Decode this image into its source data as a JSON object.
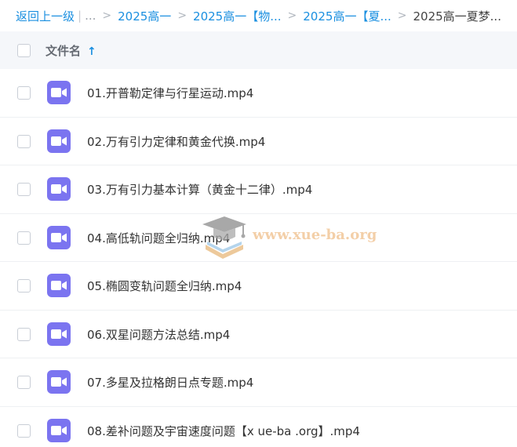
{
  "breadcrumb": {
    "back_label": "返回上一级",
    "ellipsis": "...",
    "items": [
      "2025高一",
      "2025高一【物...",
      "2025高一【夏...",
      "2025高一夏梦..."
    ]
  },
  "header": {
    "column_label": "文件名",
    "sort_icon": "↑"
  },
  "files": [
    {
      "name": "01.开普勒定律与行星运动.mp4",
      "icon": "video-file-icon"
    },
    {
      "name": "02.万有引力定律和黄金代换.mp4",
      "icon": "video-file-icon"
    },
    {
      "name": "03.万有引力基本计算（黄金十二律）.mp4",
      "icon": "video-file-icon"
    },
    {
      "name": "04.高低轨问题全归纳.mp4",
      "icon": "video-file-icon"
    },
    {
      "name": "05.椭圆变轨问题全归纳.mp4",
      "icon": "video-file-icon"
    },
    {
      "name": "06.双星问题方法总结.mp4",
      "icon": "video-file-icon"
    },
    {
      "name": "07.多星及拉格朗日点专题.mp4",
      "icon": "video-file-icon"
    },
    {
      "name": "08.差补问题及宇宙速度问题【x ue-ba .org】.mp4",
      "icon": "video-file-icon"
    }
  ],
  "watermark": {
    "text": "www.xue-ba.org"
  },
  "colors": {
    "link": "#1a8fe0",
    "file_icon": "#7b74f0",
    "header_bg": "#f5f7fa"
  }
}
